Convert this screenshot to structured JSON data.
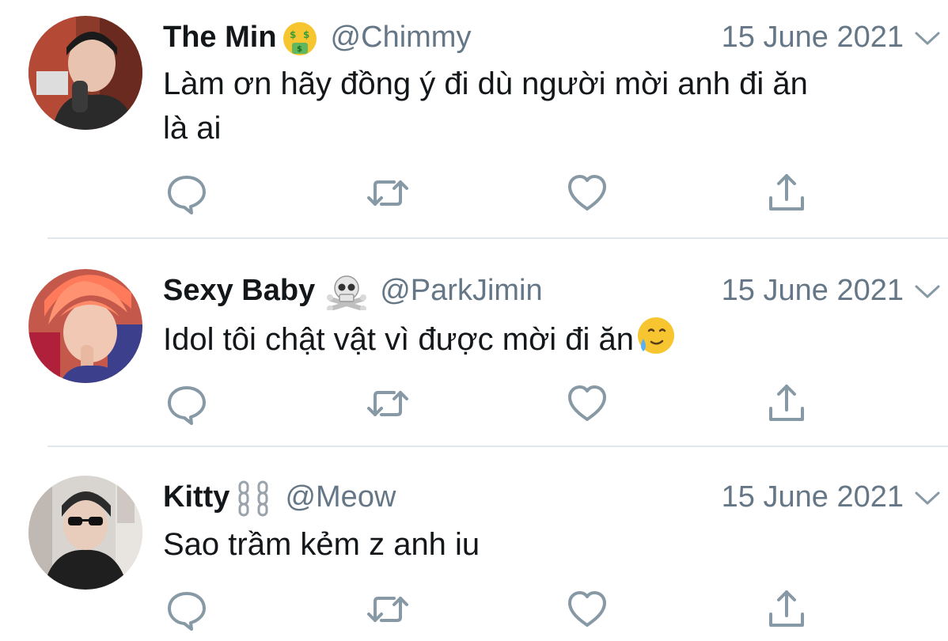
{
  "tweets": [
    {
      "display_name": "The Min",
      "name_emoji": "money-mouth-face-emoji",
      "handle": "@Chimmy",
      "date": "15 June 2021",
      "text_line1": "Làm ơn hãy đồng ý đi dù người mời anh đi ăn",
      "text_line2": "là ai"
    },
    {
      "display_name": "Sexy Baby",
      "name_emoji": "skull-and-crossbones-emoji",
      "handle": "@ParkJimin",
      "date": "15 June 2021",
      "text_line1": "Idol tôi chật vật vì được mời đi ăn",
      "text_emoji": "smiling-face-with-tear-emoji"
    },
    {
      "display_name": "Kitty",
      "name_emoji": "chains-emoji",
      "handle": "@Meow",
      "date": "15 June 2021",
      "text_line1": "Sao trầm kẻm z anh iu"
    }
  ],
  "icons": {
    "reply": "reply-bubble-icon",
    "retweet": "retweet-icon",
    "like": "heart-icon",
    "share": "share-upload-icon",
    "caret": "chevron-down-icon"
  },
  "colors": {
    "text": "#14171a",
    "secondary": "#657786",
    "divider": "#e1e8ed",
    "background": "#ffffff"
  }
}
